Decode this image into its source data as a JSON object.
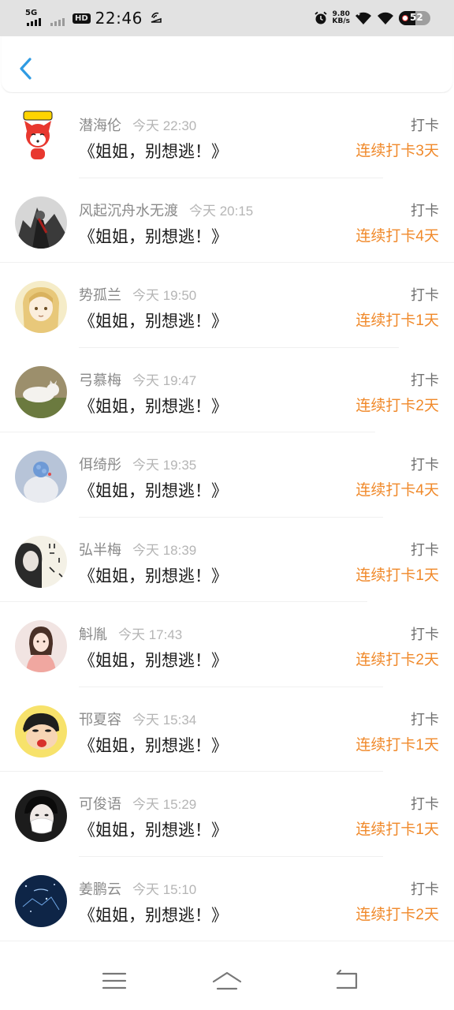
{
  "status_bar": {
    "net_label": "5G",
    "hd_label": "HD",
    "time": "22:46",
    "speed_value": "9.80",
    "speed_unit": "KB/s",
    "battery_level": "52"
  },
  "header": {
    "back_icon": "chevron-left-icon"
  },
  "checkins": [
    {
      "name": "潜海伦",
      "time": "今天 22:30",
      "title": "《姐姐，别想逃！》",
      "action": "打卡",
      "streak": "连续打卡3天"
    },
    {
      "name": "风起沉舟水无渡",
      "time": "今天 20:15",
      "title": "《姐姐，别想逃！》",
      "action": "打卡",
      "streak": "连续打卡4天"
    },
    {
      "name": "势孤兰",
      "time": "今天 19:50",
      "title": "《姐姐，别想逃！》",
      "action": "打卡",
      "streak": "连续打卡1天"
    },
    {
      "name": "弓慕梅",
      "time": "今天 19:47",
      "title": "《姐姐，别想逃！》",
      "action": "打卡",
      "streak": "连续打卡2天"
    },
    {
      "name": "佴绮彤",
      "time": "今天 19:35",
      "title": "《姐姐，别想逃！》",
      "action": "打卡",
      "streak": "连续打卡4天"
    },
    {
      "name": "弘半梅",
      "time": "今天 18:39",
      "title": "《姐姐，别想逃！》",
      "action": "打卡",
      "streak": "连续打卡1天"
    },
    {
      "name": "斛胤",
      "time": "今天 17:43",
      "title": "《姐姐，别想逃！》",
      "action": "打卡",
      "streak": "连续打卡2天"
    },
    {
      "name": "邗夏容",
      "time": "今天 15:34",
      "title": "《姐姐，别想逃！》",
      "action": "打卡",
      "streak": "连续打卡1天"
    },
    {
      "name": "可俊语",
      "time": "今天 15:29",
      "title": "《姐姐，别想逃！》",
      "action": "打卡",
      "streak": "连续打卡1天"
    },
    {
      "name": "姜鹏云",
      "time": "今天 15:10",
      "title": "《姐姐，别想逃！》",
      "action": "打卡",
      "streak": "连续打卡2天"
    }
  ],
  "nav_bar": {
    "menu_icon": "menu-icon",
    "home_icon": "home-icon",
    "back_icon": "back-icon"
  },
  "colors": {
    "accent": "#f0892a",
    "back_blue": "#2f9be3",
    "status_bg": "#e2e2e2"
  }
}
